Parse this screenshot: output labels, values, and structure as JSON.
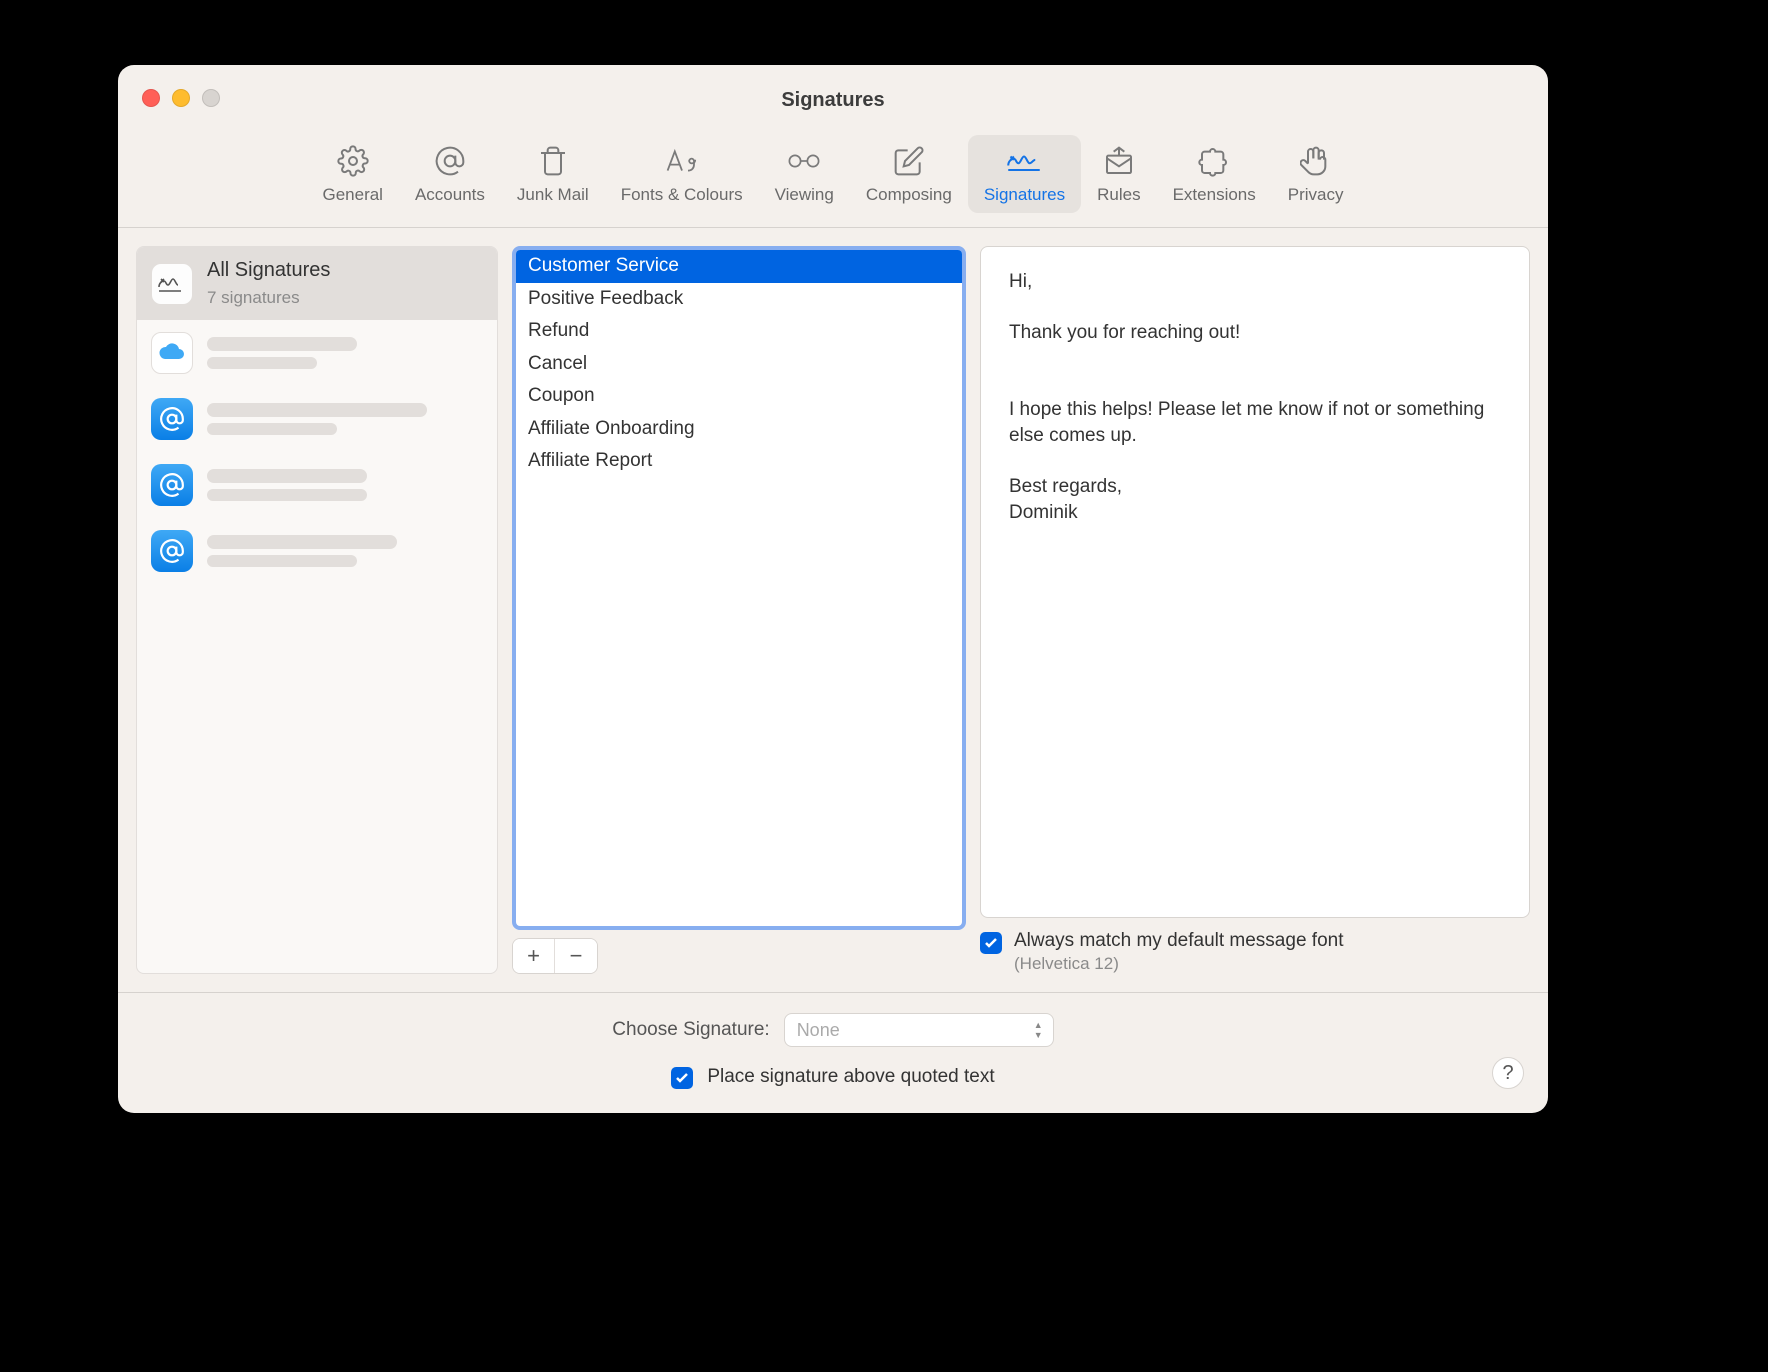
{
  "window": {
    "title": "Signatures"
  },
  "toolbar": {
    "items": [
      {
        "label": "General"
      },
      {
        "label": "Accounts"
      },
      {
        "label": "Junk Mail"
      },
      {
        "label": "Fonts & Colours"
      },
      {
        "label": "Viewing"
      },
      {
        "label": "Composing"
      },
      {
        "label": "Signatures"
      },
      {
        "label": "Rules"
      },
      {
        "label": "Extensions"
      },
      {
        "label": "Privacy"
      }
    ]
  },
  "sidebar": {
    "all": {
      "title": "All Signatures",
      "sub": "7 signatures"
    }
  },
  "signatures": [
    "Customer Service",
    "Positive Feedback",
    "Refund",
    "Cancel",
    "Coupon",
    "Affiliate Onboarding",
    "Affiliate Report"
  ],
  "preview": "Hi,\n\nThank you for reaching out!\n\n\nI hope this helps! Please let me know if not or something else comes up.\n\nBest regards,\nDominik",
  "options": {
    "match_font_label": "Always match my default message font",
    "match_font_sub": "(Helvetica 12)",
    "choose_label": "Choose Signature:",
    "choose_value": "None",
    "place_above_label": "Place signature above quoted text"
  }
}
